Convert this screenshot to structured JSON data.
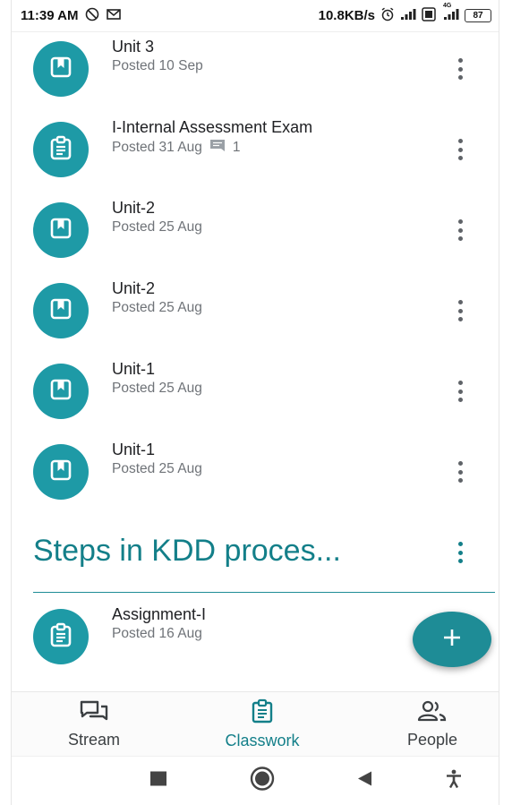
{
  "status_bar": {
    "time": "11:39 AM",
    "speed": "10.8KB/s",
    "battery": "87",
    "network_label": "4G"
  },
  "items": [
    {
      "title": "Unit 3",
      "posted": "Posted 10 Sep",
      "icon": "book-icon",
      "comments": ""
    },
    {
      "title": "I-Internal Assessment Exam",
      "posted": "Posted 31 Aug",
      "icon": "assignment-icon",
      "comments": "1"
    },
    {
      "title": "Unit-2",
      "posted": "Posted 25 Aug",
      "icon": "book-icon",
      "comments": ""
    },
    {
      "title": "Unit-2",
      "posted": "Posted 25 Aug",
      "icon": "book-icon",
      "comments": ""
    },
    {
      "title": "Unit-1",
      "posted": "Posted 25 Aug",
      "icon": "book-icon",
      "comments": ""
    },
    {
      "title": "Unit-1",
      "posted": "Posted 25 Aug",
      "icon": "book-icon",
      "comments": ""
    }
  ],
  "topic": {
    "title": "Steps in KDD proces..."
  },
  "topic_items": [
    {
      "title": "Assignment-I",
      "posted": "Posted 16 Aug",
      "icon": "assignment-icon"
    }
  ],
  "bottom_nav": {
    "tabs": [
      {
        "label": "Stream",
        "icon": "stream-icon",
        "active": false
      },
      {
        "label": "Classwork",
        "icon": "classwork-icon",
        "active": true
      },
      {
        "label": "People",
        "icon": "people-icon",
        "active": false
      }
    ]
  },
  "colors": {
    "accent": "#1e9aa6",
    "accent_dark": "#137f89",
    "text_primary": "#202124",
    "text_secondary": "#6f7378"
  }
}
